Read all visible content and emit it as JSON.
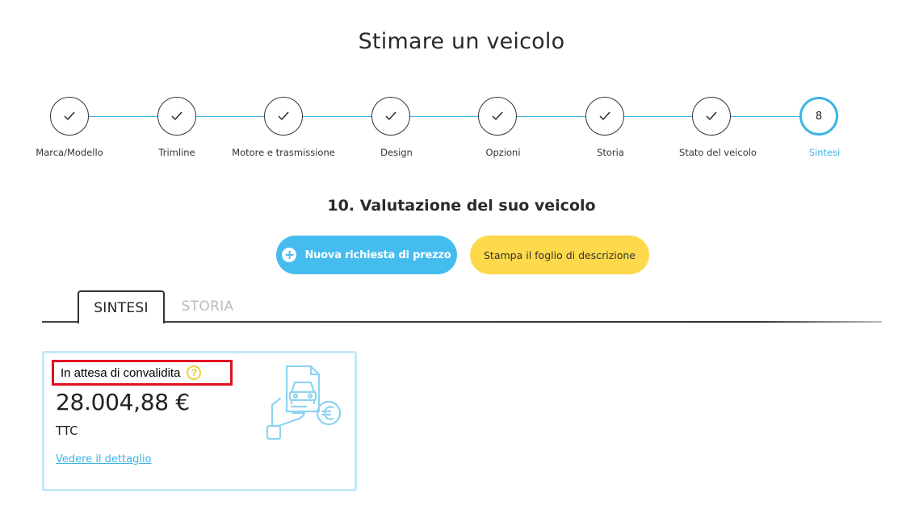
{
  "page": {
    "title": "Stimare un veicolo"
  },
  "stepper": {
    "steps": [
      {
        "label": "Marca/Modello",
        "state": "done"
      },
      {
        "label": "Trimline",
        "state": "done"
      },
      {
        "label": "Motore e trasmissione",
        "state": "done"
      },
      {
        "label": "Design",
        "state": "done"
      },
      {
        "label": "Opzioni",
        "state": "done"
      },
      {
        "label": "Storia",
        "state": "done"
      },
      {
        "label": "Stato del veicolo",
        "state": "done"
      },
      {
        "label": "Sintesi",
        "state": "active",
        "number": "8"
      }
    ]
  },
  "section": {
    "title": "10. Valutazione del suo veicolo"
  },
  "actions": {
    "new_request_label": "Nuova richiesta di prezzo",
    "print_label": "Stampa il foglio di descrizione"
  },
  "tabs": {
    "summary": "SINTESI",
    "history": "STORIA"
  },
  "valuation": {
    "status": "In attesa di convalidita",
    "help_icon": "question-circle-icon",
    "price": "28.004,88 €",
    "tax": "TTC",
    "detail_link": "Vedere il dettaglio",
    "illustration": "hand-car-document-euro-icon"
  },
  "colors": {
    "accent": "#3cb4e5",
    "primary_button": "#45bcee",
    "secondary_button": "#fdd94b",
    "card_border": "#c3e9f7",
    "status_highlight": "#e01020"
  }
}
